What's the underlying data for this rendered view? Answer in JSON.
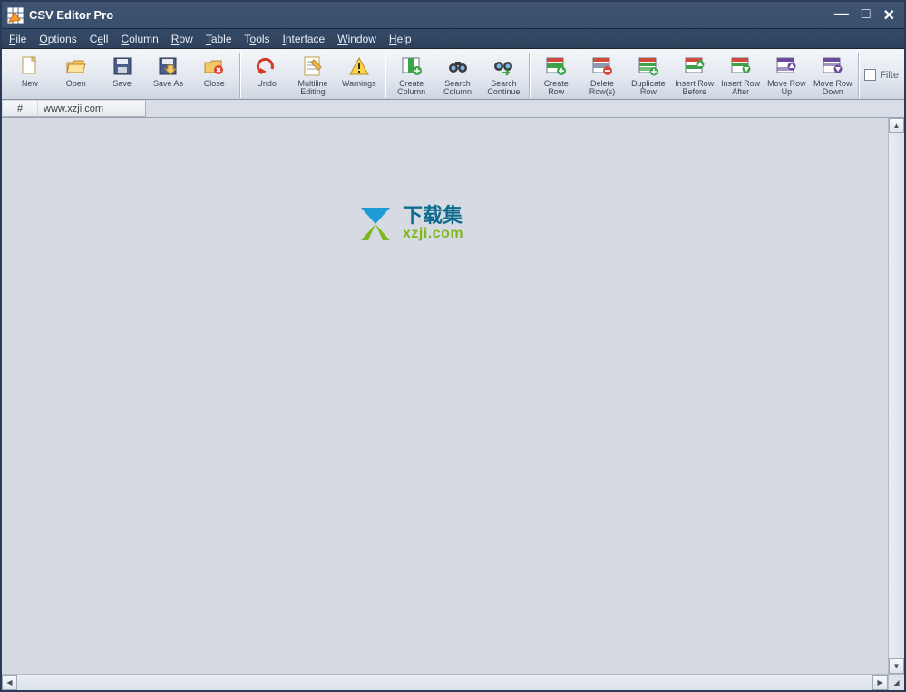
{
  "window": {
    "title": "CSV Editor Pro"
  },
  "menu": {
    "file": "File",
    "options": "Options",
    "cell": "Cell",
    "column": "Column",
    "row": "Row",
    "table": "Table",
    "tools": "Tools",
    "interface": "Interface",
    "window": "Window",
    "help": "Help"
  },
  "toolbar": {
    "new": "New",
    "open": "Open",
    "save": "Save",
    "saveas": "Save As",
    "close": "Close",
    "undo": "Undo",
    "multiline": "Multiline\nEditing",
    "warnings": "Warnings",
    "createcol": "Create\nColumn",
    "searchcol": "Search\nColumn",
    "searchcont": "Search\nContinue",
    "createrow": "Create\nRow",
    "deleterow": "Delete\nRow(s)",
    "duprow": "Duplicate\nRow",
    "insbefore": "Insert Row\nBefore",
    "insafter": "Insert Row\nAfter",
    "moveup": "Move Row\nUp",
    "movedown": "Move Row\nDown",
    "filter": "Filte"
  },
  "grid": {
    "rowheader": "#",
    "col1": "www.xzji.com"
  },
  "watermark": {
    "line1": "下载集",
    "line2": "xzji.com"
  }
}
